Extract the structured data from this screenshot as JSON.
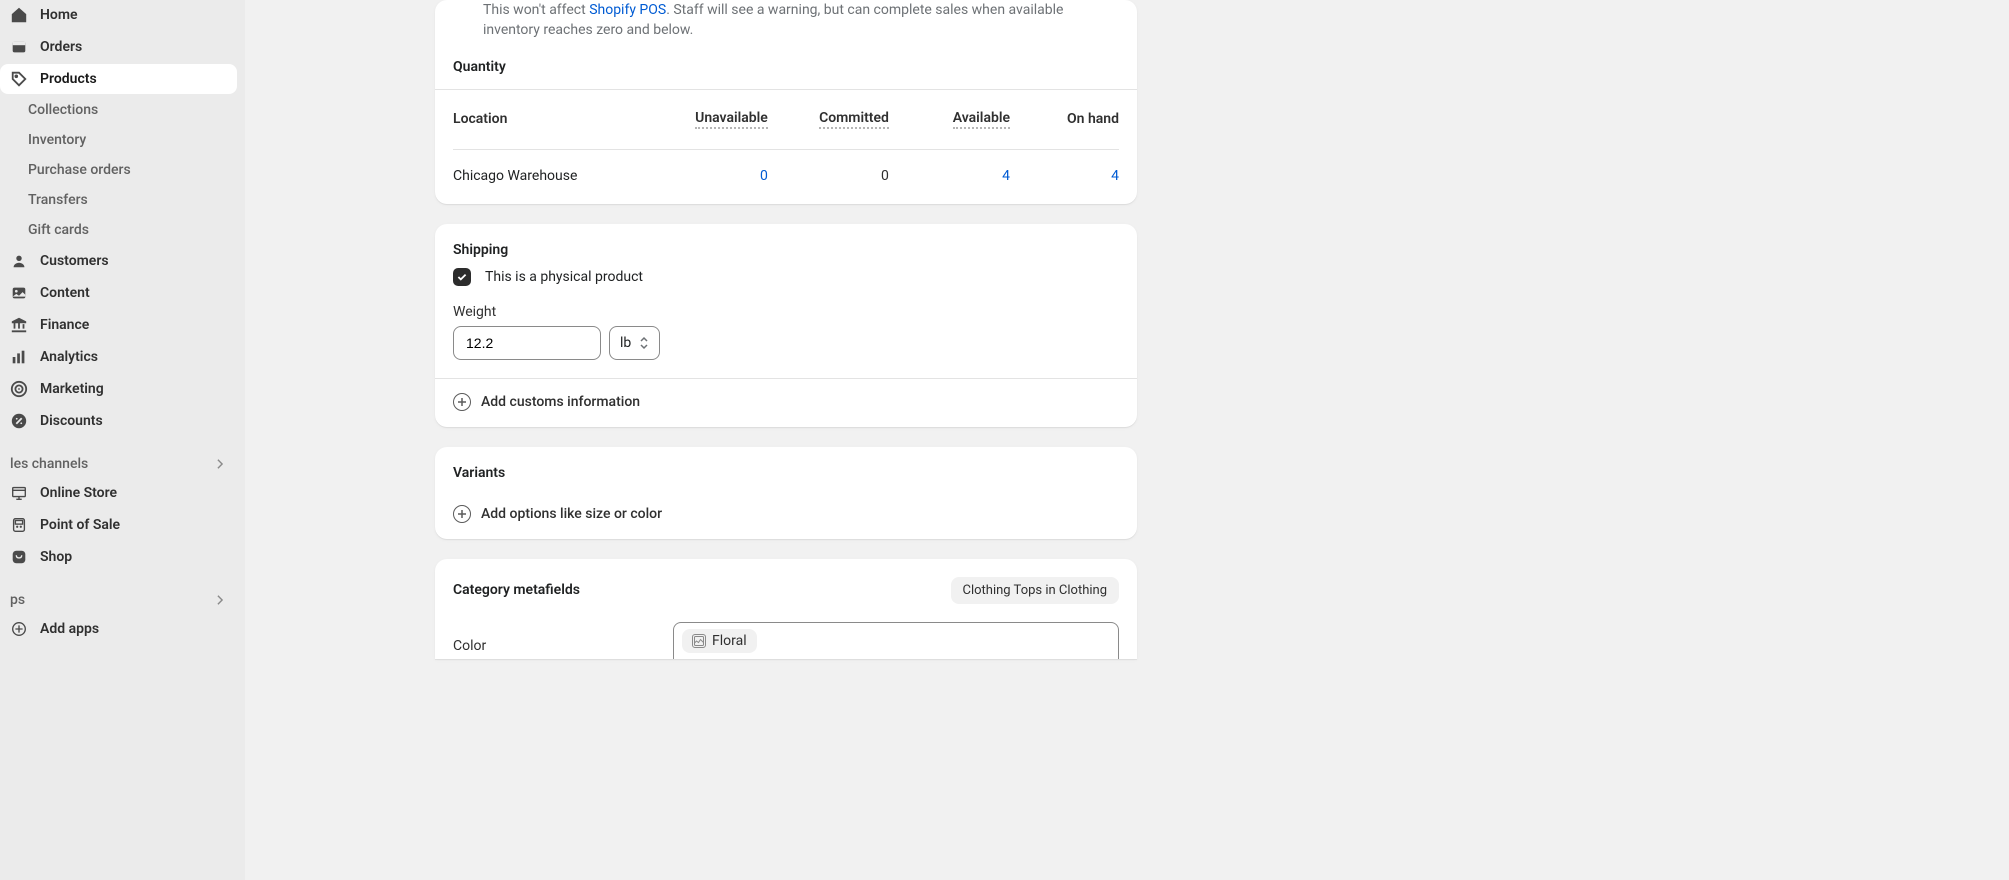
{
  "sidebar": {
    "primary": [
      {
        "label": "Home"
      },
      {
        "label": "Orders"
      },
      {
        "label": "Products",
        "active": true
      },
      {
        "label": "Collections",
        "sub": true
      },
      {
        "label": "Inventory",
        "sub": true
      },
      {
        "label": "Purchase orders",
        "sub": true
      },
      {
        "label": "Transfers",
        "sub": true
      },
      {
        "label": "Gift cards",
        "sub": true
      },
      {
        "label": "Customers"
      },
      {
        "label": "Content"
      },
      {
        "label": "Finance"
      },
      {
        "label": "Analytics"
      },
      {
        "label": "Marketing"
      },
      {
        "label": "Discounts"
      }
    ],
    "sections": {
      "channels_label": "les channels",
      "apps_label": "ps"
    },
    "channels": [
      {
        "label": "Online Store"
      },
      {
        "label": "Point of Sale"
      },
      {
        "label": "Shop"
      }
    ],
    "add_apps": "Add apps"
  },
  "inventory_card": {
    "helper_prefix": "This won't affect ",
    "helper_link": "Shopify POS",
    "helper_suffix": ". Staff will see a warning, but can complete sales when available inventory reaches zero and below.",
    "quantity_heading": "Quantity",
    "columns": {
      "location": "Location",
      "unavailable": "Unavailable",
      "committed": "Committed",
      "available": "Available",
      "on_hand": "On hand"
    },
    "rows": [
      {
        "location": "Chicago Warehouse",
        "unavailable": "0",
        "committed": "0",
        "available": "4",
        "on_hand": "4"
      }
    ]
  },
  "shipping_card": {
    "title": "Shipping",
    "physical_label": "This is a physical product",
    "weight_label": "Weight",
    "weight_value": "12.2",
    "unit": "lb",
    "add_customs": "Add customs information"
  },
  "variants_card": {
    "title": "Variants",
    "add_options": "Add options like size or color"
  },
  "metafields_card": {
    "title": "Category metafields",
    "category_badge": "Clothing Tops in Clothing",
    "fields": {
      "color_label": "Color",
      "color_chip": "Floral"
    }
  }
}
